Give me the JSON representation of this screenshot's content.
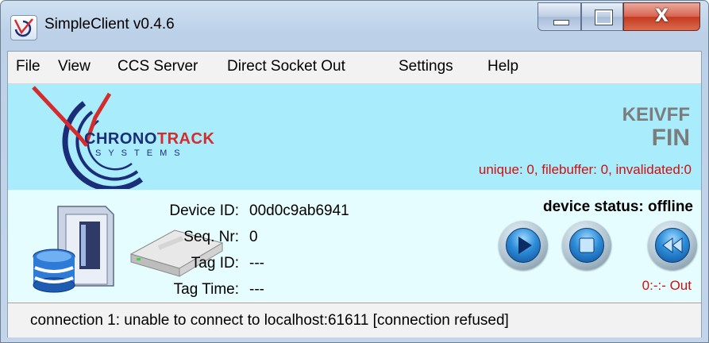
{
  "window": {
    "title": "SimpleClient v0.4.6",
    "controls": {
      "minimize": "minimize",
      "maximize": "maximize",
      "close": "X"
    }
  },
  "menu": [
    "File",
    "View",
    "CCS Server",
    "Direct Socket Out",
    "Settings",
    "Help"
  ],
  "banner": {
    "logo_name": "CHRONO",
    "logo_name_accent": "TRACK",
    "logo_sub": "SYSTEMS",
    "bib_line1": "KEIVFF",
    "bib_line2": "FIN",
    "counts": "unique: 0, filebuffer: 0, invalidated:0"
  },
  "device": {
    "device_id_label": "Device ID:",
    "device_id": "00d0c9ab6941",
    "seq_label": "Seq. Nr:",
    "seq": "0",
    "tag_id_label": "Tag ID:",
    "tag_id": "---",
    "tag_time_label": "Tag Time:",
    "tag_time": "---",
    "status": "device status: offline",
    "timer": "0:-:-  Out"
  },
  "statusbar": {
    "text": "connection 1: unable to connect to localhost:61611 [connection refused]"
  },
  "colors": {
    "banner_bg": "#a9ecfb",
    "panel_bg": "#e6fdff",
    "alert_red": "#d01010",
    "logo_blue": "#1b2d78",
    "logo_red": "#d52b2b"
  },
  "icons": [
    "chronotrack-app-icon",
    "database-server-icon",
    "hard-drive-icon",
    "play-icon",
    "stop-icon",
    "rewind-icon"
  ]
}
